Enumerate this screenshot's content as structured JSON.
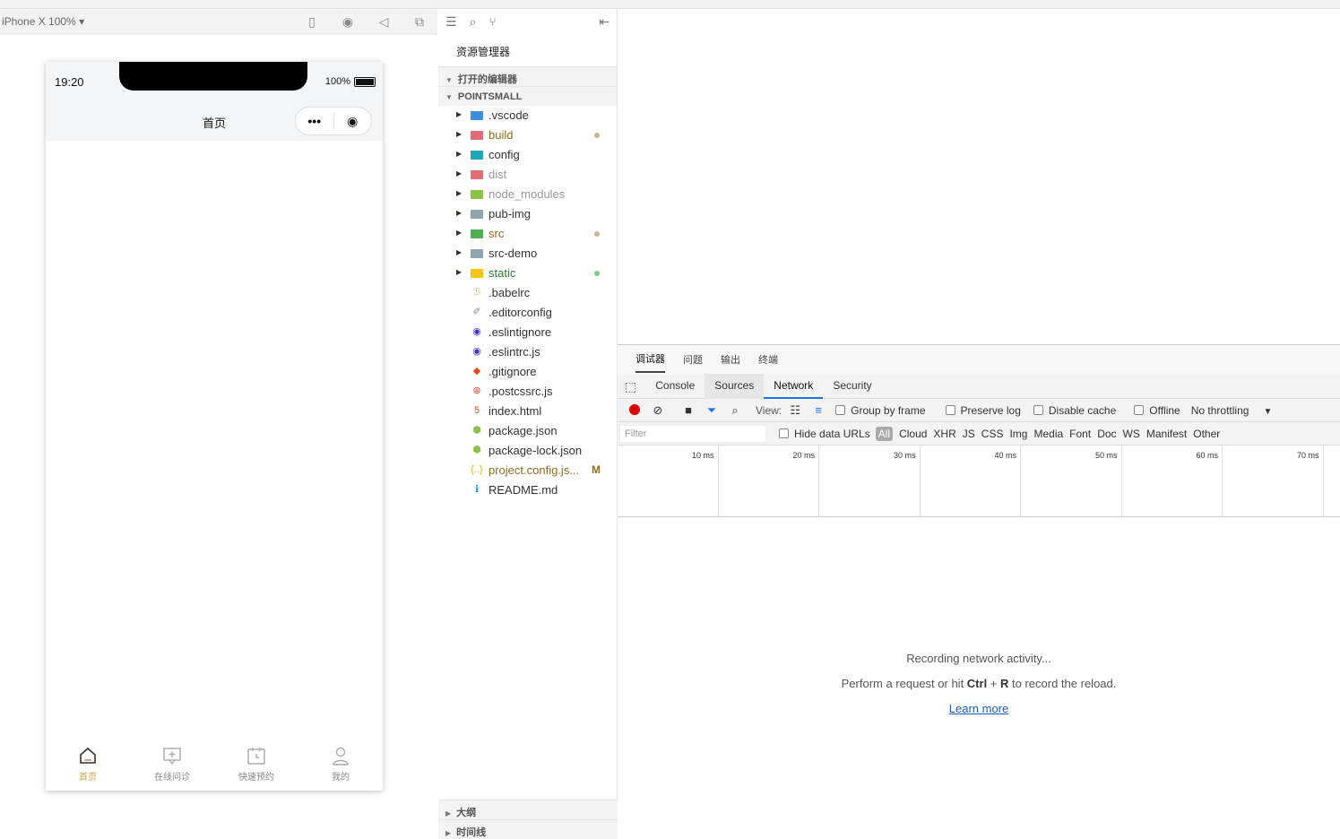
{
  "simulator": {
    "device": "iPhone X 100% ▾",
    "phone": {
      "time": "19:20",
      "battery": "100%",
      "page_title": "首页",
      "capsule_more": "•••",
      "capsule_close": "◉",
      "tabs": [
        {
          "label": "首页",
          "icon": "home-icon"
        },
        {
          "label": "在线问诊",
          "icon": "consult-icon"
        },
        {
          "label": "快速预约",
          "icon": "calendar-icon"
        },
        {
          "label": "我的",
          "icon": "user-icon"
        }
      ]
    }
  },
  "explorer": {
    "title": "资源管理器",
    "open_editors": "打开的编辑器",
    "project": "POINTSMALL",
    "items": [
      {
        "name": ".vscode",
        "type": "folder",
        "color": "#3b8fd8",
        "text_color": "#333"
      },
      {
        "name": "build",
        "type": "folder",
        "color": "#e06c75",
        "text_color": "#8a6d1f",
        "dot": "#c8b48a"
      },
      {
        "name": "config",
        "type": "folder",
        "color": "#1fa7b8",
        "text_color": "#333"
      },
      {
        "name": "dist",
        "type": "folder",
        "color": "#e06c75",
        "text_color": "#999"
      },
      {
        "name": "node_modules",
        "type": "folder",
        "color": "#8bc34a",
        "text_color": "#999"
      },
      {
        "name": "pub-img",
        "type": "folder",
        "color": "#90a4ae",
        "text_color": "#333"
      },
      {
        "name": "src",
        "type": "folder",
        "color": "#4caf50",
        "text_color": "#8a6d1f",
        "dot": "#c8b48a"
      },
      {
        "name": "src-demo",
        "type": "folder",
        "color": "#90a4ae",
        "text_color": "#333"
      },
      {
        "name": "static",
        "type": "folder",
        "color": "#f5c518",
        "text_color": "#2e7d32",
        "dot": "#81c784"
      },
      {
        "name": ".babelrc",
        "type": "file",
        "glyph": "ℬ",
        "color": "#e5c07b",
        "text_color": "#333"
      },
      {
        "name": ".editorconfig",
        "type": "file",
        "glyph": "✐",
        "color": "#888",
        "text_color": "#333"
      },
      {
        "name": ".eslintignore",
        "type": "file",
        "glyph": "◉",
        "color": "#4b32c3",
        "text_color": "#333"
      },
      {
        "name": ".eslintrc.js",
        "type": "file",
        "glyph": "◉",
        "color": "#4b32c3",
        "text_color": "#333"
      },
      {
        "name": ".gitignore",
        "type": "file",
        "glyph": "◆",
        "color": "#e64a19",
        "text_color": "#333"
      },
      {
        "name": ".postcssrc.js",
        "type": "file",
        "glyph": "⊛",
        "color": "#e53935",
        "text_color": "#333"
      },
      {
        "name": "index.html",
        "type": "file",
        "glyph": "5",
        "color": "#e44d26",
        "text_color": "#333"
      },
      {
        "name": "package.json",
        "type": "file",
        "glyph": "⬢",
        "color": "#8bc34a",
        "text_color": "#333"
      },
      {
        "name": "package-lock.json",
        "type": "file",
        "glyph": "⬢",
        "color": "#8bc34a",
        "text_color": "#333"
      },
      {
        "name": "project.config.js...",
        "type": "file",
        "glyph": "{..}",
        "color": "#e5b30b",
        "text_color": "#8a6d1f",
        "mark": "M"
      },
      {
        "name": "README.md",
        "type": "file",
        "glyph": "ℹ",
        "color": "#2196f3",
        "text_color": "#333"
      }
    ],
    "outline": "大纲",
    "timeline": "时间线"
  },
  "devtools": {
    "top_tabs": [
      "调试器",
      "问题",
      "输出",
      "终端"
    ],
    "panel_tabs": [
      "Console",
      "Sources",
      "Network",
      "Security"
    ],
    "active_panel": "Network",
    "toolbar": {
      "view_label": "View:",
      "group_by_frame": "Group by frame",
      "preserve_log": "Preserve log",
      "disable_cache": "Disable cache",
      "offline": "Offline",
      "throttling": "No throttling"
    },
    "filter": {
      "placeholder": "Filter",
      "hide_data_urls": "Hide data URLs",
      "types": [
        "All",
        "Cloud",
        "XHR",
        "JS",
        "CSS",
        "Img",
        "Media",
        "Font",
        "Doc",
        "WS",
        "Manifest",
        "Other"
      ]
    },
    "timeline_ticks": [
      "10 ms",
      "20 ms",
      "30 ms",
      "40 ms",
      "50 ms",
      "60 ms",
      "70 ms"
    ],
    "empty": {
      "line1": "Recording network activity...",
      "line2_pre": "Perform a request or hit ",
      "key1": "Ctrl",
      "plus": " + ",
      "key2": "R",
      "line2_post": " to record the reload.",
      "learn_more": "Learn more"
    },
    "colors": {
      "record": "#e00000",
      "accent": "#1a73e8"
    }
  }
}
